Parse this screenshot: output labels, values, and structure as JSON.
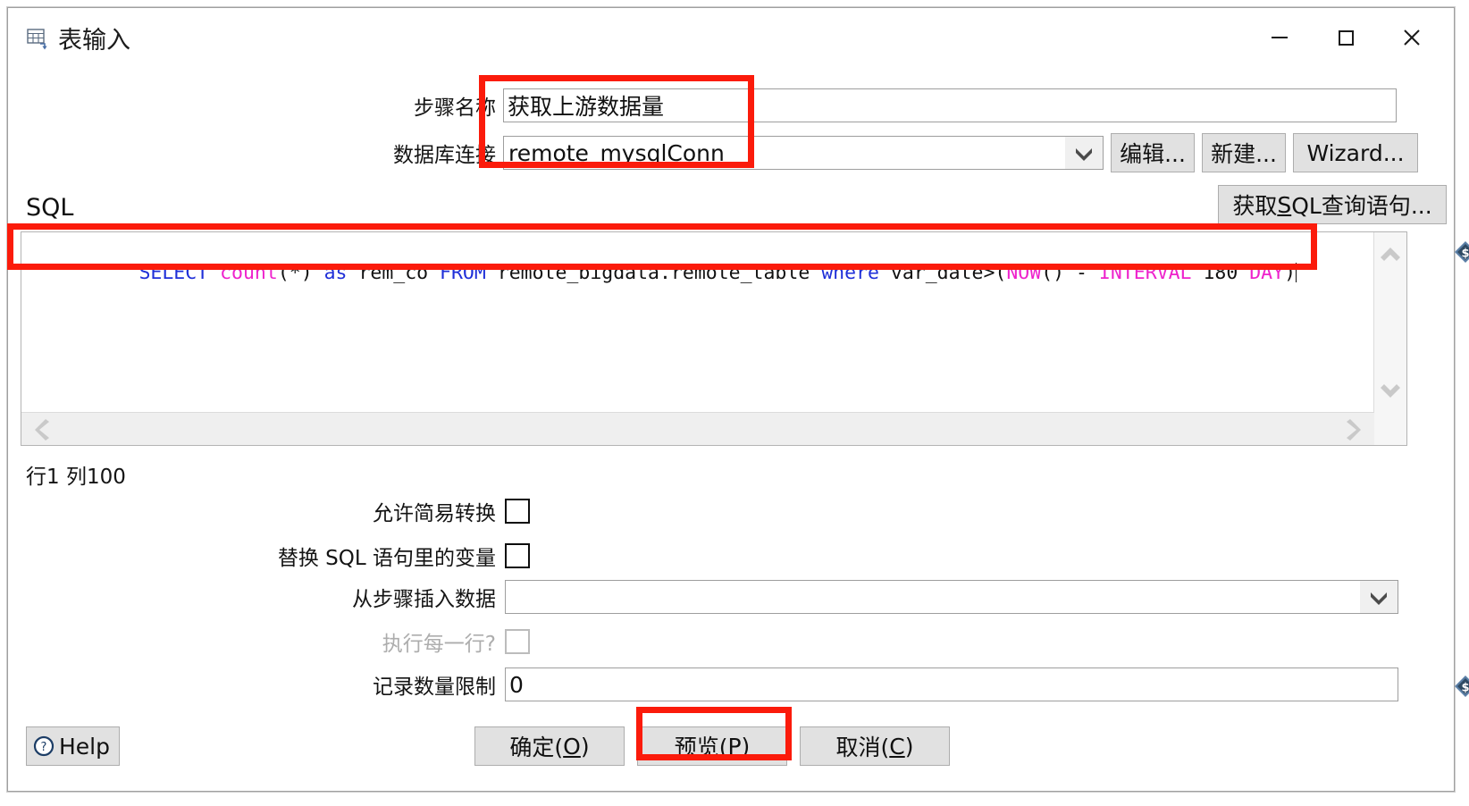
{
  "window": {
    "title": "表输入",
    "icon": "table-input-icon",
    "controls": {
      "minimize": "minimize-icon",
      "maximize": "maximize-icon",
      "close": "close-icon"
    }
  },
  "form": {
    "step_name": {
      "label": "步骤名称",
      "value": "获取上游数据量"
    },
    "db_connection": {
      "label": "数据库连接",
      "value": "remote_mysqlConn",
      "buttons": {
        "edit": "编辑...",
        "new": "新建...",
        "wizard": "Wizard..."
      }
    }
  },
  "sql": {
    "section_label": "SQL",
    "get_sql_button": {
      "prefix": "获取",
      "mnemonic": "S",
      "suffix": "QL查询语句..."
    },
    "statement": "SELECT count(*) as rem_co FROM remote_bigdata.remote_table where var_date>(NOW() - INTERVAL 180 DAY)",
    "tokens": [
      {
        "t": "SELECT",
        "c": "kw"
      },
      {
        "t": " ",
        "c": "plain"
      },
      {
        "t": "count",
        "c": "fn"
      },
      {
        "t": "(*) ",
        "c": "plain"
      },
      {
        "t": "as",
        "c": "kw"
      },
      {
        "t": " rem_co ",
        "c": "plain"
      },
      {
        "t": "FROM",
        "c": "kw"
      },
      {
        "t": " remote_bigdata.remote_table ",
        "c": "plain"
      },
      {
        "t": "where",
        "c": "kw"
      },
      {
        "t": " var_date>(",
        "c": "plain"
      },
      {
        "t": "NOW",
        "c": "fn"
      },
      {
        "t": "() - ",
        "c": "plain"
      },
      {
        "t": "INTERVAL",
        "c": "fn"
      },
      {
        "t": " 180 ",
        "c": "plain"
      },
      {
        "t": "DAY",
        "c": "fn"
      },
      {
        "t": ")",
        "c": "plain"
      }
    ],
    "caret_position": "行1 列100",
    "status": "行1 列100",
    "variable_icon": "dollar-variable-icon"
  },
  "options": {
    "allow_lazy_conversion": {
      "label": "允许简易转换",
      "checked": false
    },
    "replace_variables": {
      "label": "替换 SQL 语句里的变量",
      "checked": false
    },
    "insert_data_from_step": {
      "label": "从步骤插入数据",
      "value": ""
    },
    "execute_for_each_row": {
      "label": "执行每一行?",
      "checked": false,
      "disabled": true
    },
    "limit_size": {
      "label": "记录数量限制",
      "value": "0"
    }
  },
  "footer": {
    "help": "Help",
    "ok": {
      "prefix": "确定(",
      "mnemonic": "O",
      "suffix": ")"
    },
    "preview": {
      "prefix": "预览(",
      "mnemonic": "P",
      "suffix": ")"
    },
    "cancel": {
      "prefix": "取消(",
      "mnemonic": "C",
      "suffix": ")"
    }
  },
  "annotations": {
    "color": "#fb1b0b",
    "highlighted": [
      "step-name-and-connection-fields",
      "sql-statement-line",
      "preview-button"
    ]
  }
}
